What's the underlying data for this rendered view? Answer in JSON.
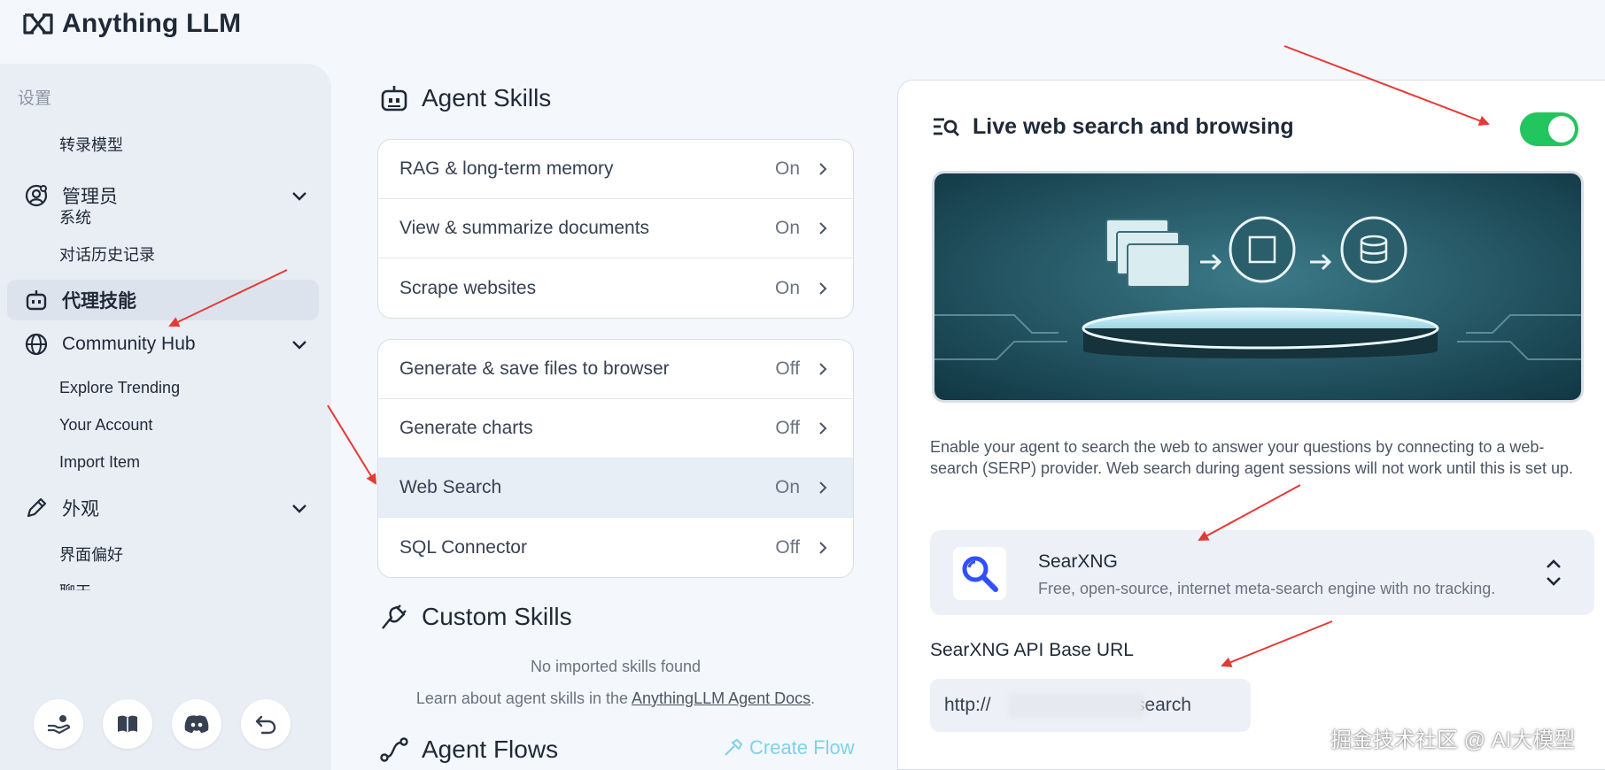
{
  "brand": {
    "name": "Anything LLM"
  },
  "sidebar": {
    "section_settings": "设置",
    "item_transcription": "转录模型",
    "admin": {
      "label": "管理员",
      "items": [
        "系统",
        "对话历史记录"
      ]
    },
    "agent_skills": {
      "label": "代理技能"
    },
    "community_hub": {
      "label": "Community Hub",
      "items": [
        "Explore Trending",
        "Your Account",
        "Import Item"
      ]
    },
    "appearance": {
      "label": "外观",
      "items": [
        "界面偏好",
        "聊天"
      ]
    },
    "bottom_icons": [
      "support-icon",
      "book-icon",
      "discord-icon",
      "back-icon"
    ]
  },
  "agent_skills": {
    "title": "Agent Skills",
    "default_skills": [
      {
        "label": "RAG & long-term memory",
        "status": "On"
      },
      {
        "label": "View & summarize documents",
        "status": "On"
      },
      {
        "label": "Scrape websites",
        "status": "On"
      }
    ],
    "configurable_skills": [
      {
        "label": "Generate & save files to browser",
        "status": "Off"
      },
      {
        "label": "Generate charts",
        "status": "Off"
      },
      {
        "label": "Web Search",
        "status": "On"
      },
      {
        "label": "SQL Connector",
        "status": "Off"
      }
    ]
  },
  "custom_skills": {
    "title": "Custom Skills",
    "empty": "No imported skills found",
    "learn_prefix": "Learn about agent skills in the ",
    "learn_link": "AnythingLLM Agent Docs",
    "learn_suffix": "."
  },
  "agent_flows": {
    "title": "Agent Flows",
    "create_label": "Create Flow"
  },
  "panel": {
    "title": "Live web search and browsing",
    "enabled": true,
    "description": "Enable your agent to search the web to answer your questions by connecting to a web-search (SERP) provider. Web search during agent sessions will not work until this is set up.",
    "provider": {
      "name": "SearXNG",
      "description": "Free, open-source, internet meta-search engine with no tracking."
    },
    "url_label": "SearXNG API Base URL",
    "url_value": "http://                  :8081/search"
  },
  "watermark": "掘金技术社区 @ AI大模型",
  "colors": {
    "accent_green": "#22c55e",
    "annotation_red": "#e53935",
    "flow_cyan": "#7dd3e8"
  }
}
